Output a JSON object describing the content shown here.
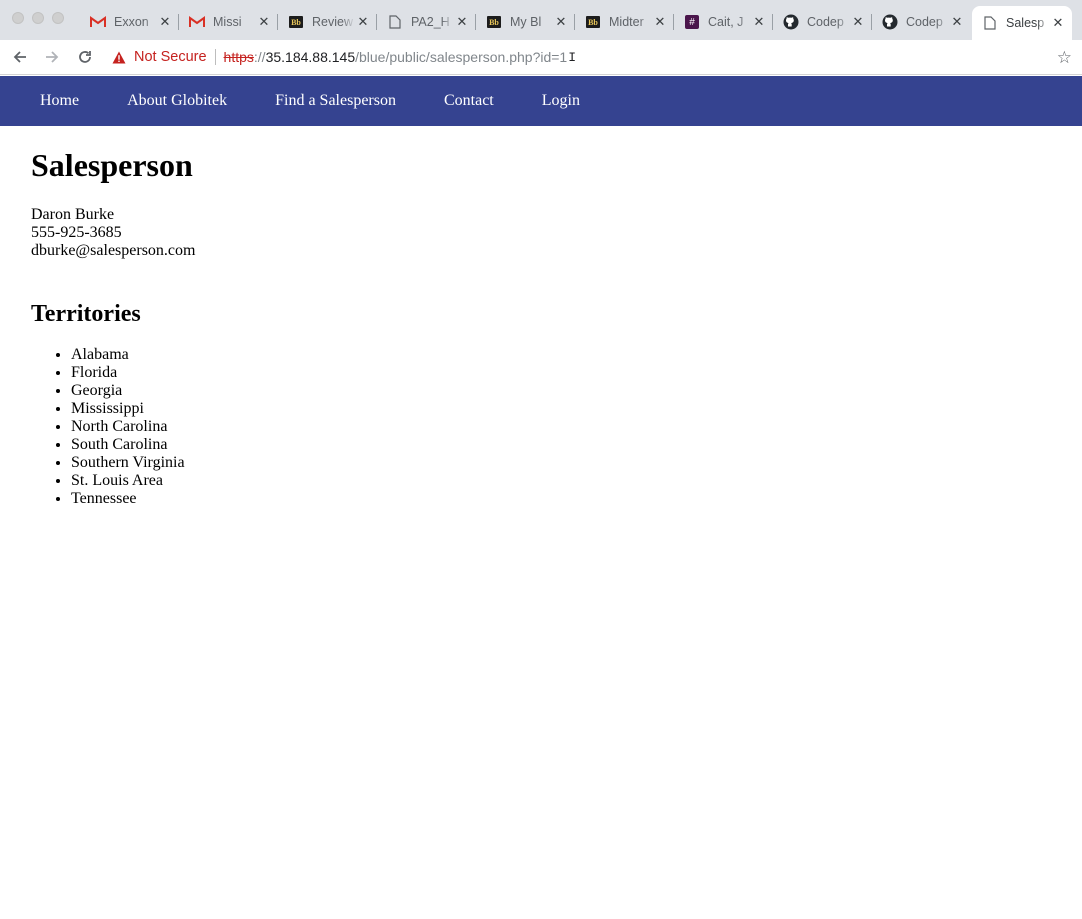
{
  "browser": {
    "tabs": [
      {
        "title": "Exxon",
        "icon": "gmail-icon"
      },
      {
        "title": "Missi",
        "icon": "gmail-icon"
      },
      {
        "title": "Review",
        "icon": "blackboard-icon"
      },
      {
        "title": "PA2_H",
        "icon": "page-icon"
      },
      {
        "title": "My Bl",
        "icon": "blackboard-icon"
      },
      {
        "title": "Midter",
        "icon": "blackboard-icon"
      },
      {
        "title": "Cait, J",
        "icon": "slack-icon"
      },
      {
        "title": "Codep",
        "icon": "github-icon"
      },
      {
        "title": "Codep",
        "icon": "github-icon"
      },
      {
        "title": "Salesp",
        "icon": "page-icon",
        "active": true
      }
    ],
    "security_label": "Not Secure",
    "url": {
      "scheme": "https",
      "separator": "://",
      "host": "35.184.88.145",
      "path": "/blue/public/salesperson.php?id=1"
    },
    "colors": {
      "nav": "#354390",
      "warning": "#c5221f"
    }
  },
  "site_nav": {
    "items": [
      "Home",
      "About Globitek",
      "Find a Salesperson",
      "Contact",
      "Login"
    ]
  },
  "page": {
    "heading": "Salesperson",
    "name": "Daron Burke",
    "phone": "555-925-3685",
    "email": "dburke@salesperson.com",
    "territories_heading": "Territories",
    "territories": [
      "Alabama",
      "Florida",
      "Georgia",
      "Mississippi",
      "North Carolina",
      "South Carolina",
      "Southern Virginia",
      "St. Louis Area",
      "Tennessee"
    ]
  }
}
